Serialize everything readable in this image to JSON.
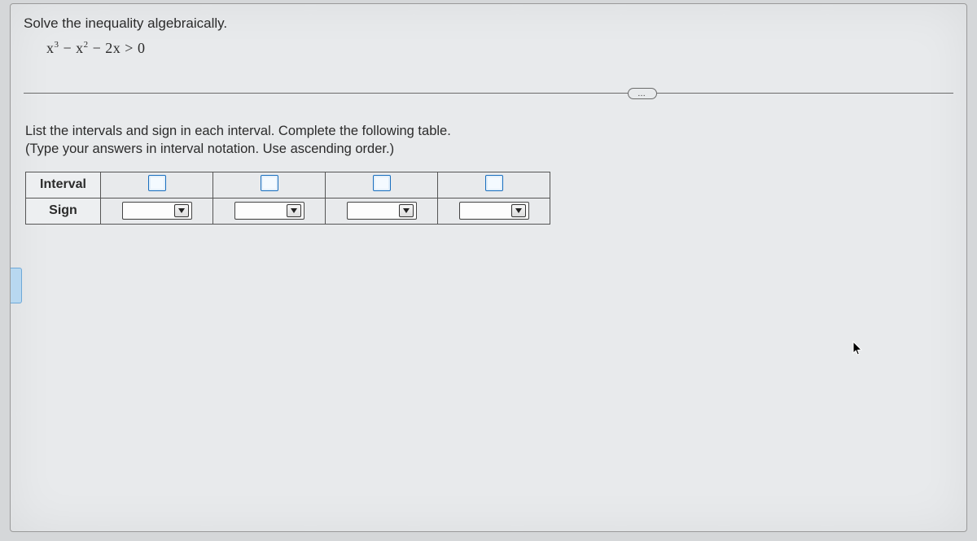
{
  "prompt": "Solve the inequality algebraically.",
  "expression_html": "x<sup>3</sup> − x<sup>2</sup> − 2x > 0",
  "more_label": "…",
  "instructions": {
    "line1": "List the intervals and sign in each interval. Complete the following table.",
    "line2": "(Type your answers in interval notation. Use ascending order.)"
  },
  "table": {
    "row_labels": [
      "Interval",
      "Sign"
    ],
    "columns": 4
  }
}
